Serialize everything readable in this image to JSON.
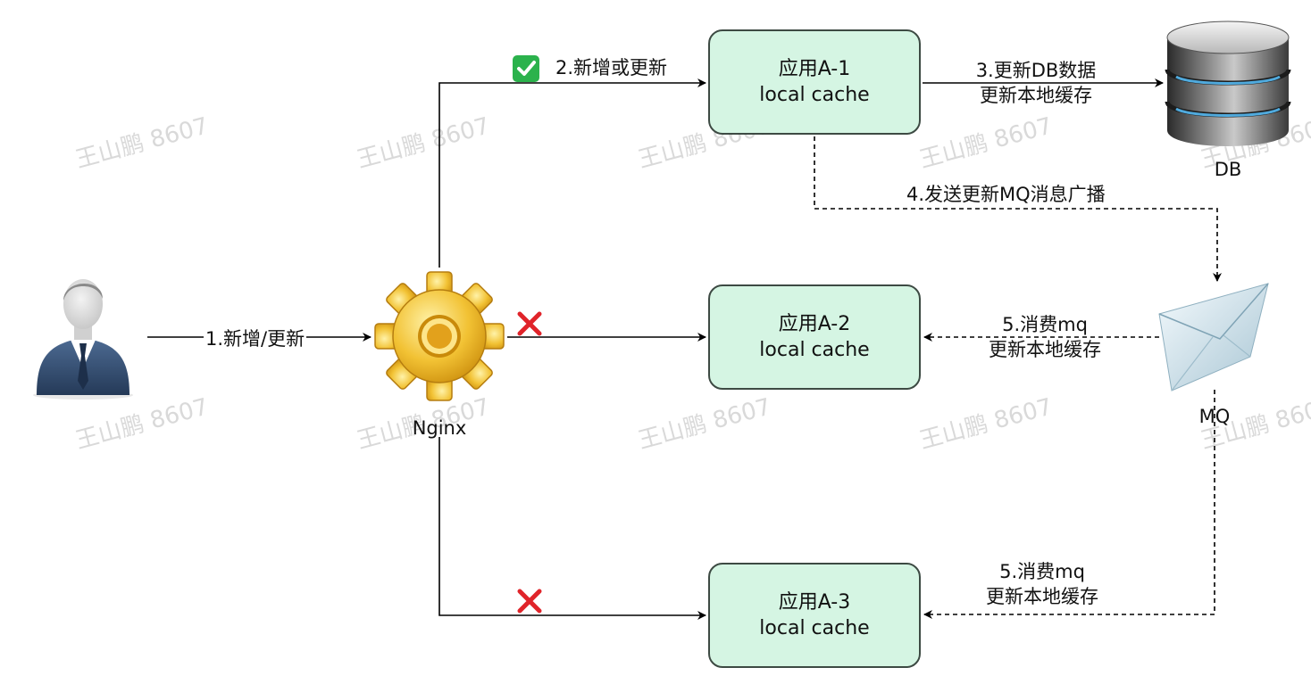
{
  "watermark": "王山鹏 8607",
  "user": {
    "icon": "businessman-icon"
  },
  "nginx": {
    "label": "Nginx",
    "icon": "gear-icon"
  },
  "db": {
    "label": "DB",
    "icon": "database-icon"
  },
  "mq": {
    "label": "MQ",
    "icon": "envelope-icon"
  },
  "apps": [
    {
      "name": "应用A-1",
      "sub": "local cache"
    },
    {
      "name": "应用A-2",
      "sub": "local cache"
    },
    {
      "name": "应用A-3",
      "sub": "local cache"
    }
  ],
  "edges": {
    "e1": "1.新增/更新",
    "e2": "2.新增或更新",
    "e3_line1": "3.更新DB数据",
    "e3_line2": "更新本地缓存",
    "e4": "4.发送更新MQ消息广播",
    "e5a_line1": "5.消费mq",
    "e5a_line2": "更新本地缓存",
    "e5b_line1": "5.消费mq",
    "e5b_line2": "更新本地缓存"
  },
  "status": {
    "ok_icon": "check-icon",
    "fail_icon": "cross-icon",
    "ok_color": "#2bb24c",
    "fail_color": "#e0242a"
  }
}
